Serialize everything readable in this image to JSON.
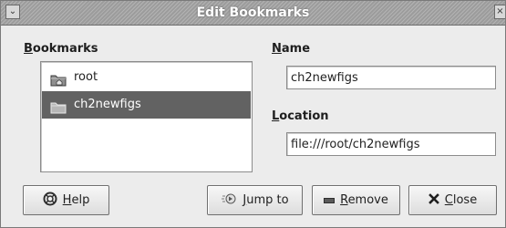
{
  "window": {
    "title": "Edit Bookmarks",
    "menu_glyph": "⌄",
    "close_glyph": "×"
  },
  "bookmarks": {
    "label_key": "B",
    "label_rest": "ookmarks",
    "items": [
      {
        "label": "root",
        "icon": "home-folder-icon",
        "selected": false
      },
      {
        "label": "ch2newfigs",
        "icon": "folder-icon",
        "selected": true
      }
    ]
  },
  "name": {
    "label_key": "N",
    "label_rest": "ame",
    "value": "ch2newfigs"
  },
  "location": {
    "label_key": "L",
    "label_rest": "ocation",
    "value": "file:///root/ch2newfigs"
  },
  "buttons": {
    "help": {
      "key": "H",
      "rest": "elp",
      "icon": "help-icon"
    },
    "jump": {
      "key": "J",
      "rest": "ump to",
      "icon": "jump-icon"
    },
    "remove": {
      "key": "R",
      "rest": "emove",
      "icon": "remove-icon"
    },
    "close": {
      "key": "C",
      "rest": "lose",
      "icon": "close-x-icon"
    }
  },
  "colors": {
    "selection_bg": "#626262",
    "titlebar": "#a8a8a8"
  }
}
